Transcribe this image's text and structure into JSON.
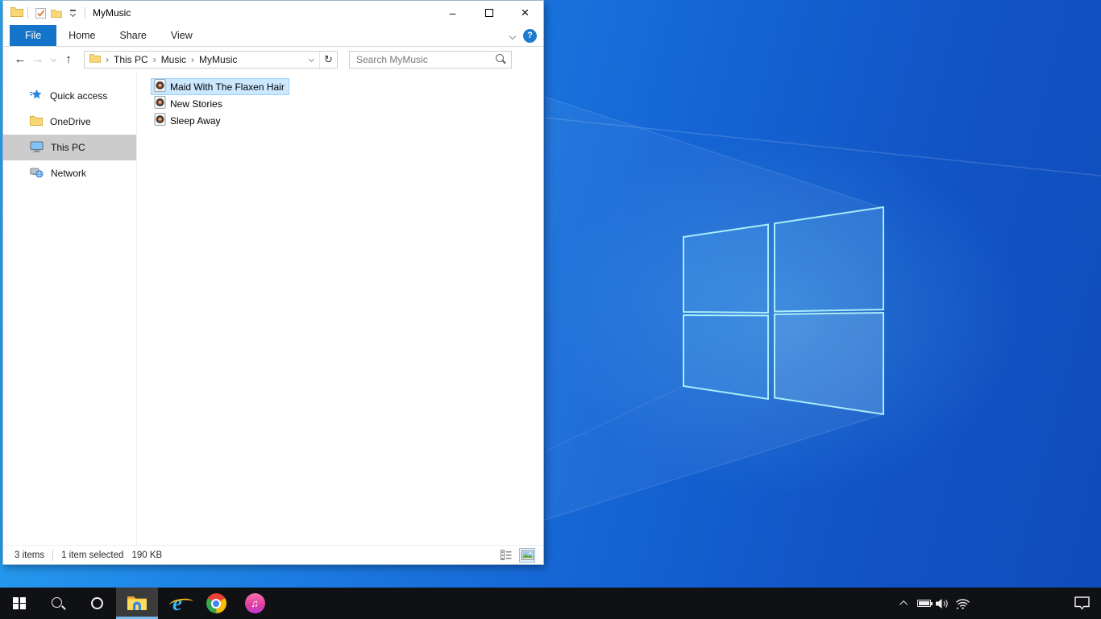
{
  "window": {
    "title": "MyMusic"
  },
  "icons": {
    "back": "←",
    "forward": "→",
    "up": "↑",
    "refresh": "↻",
    "help": "?",
    "minimize": "–",
    "close": "×",
    "check": "✓",
    "breadcrumb_sep": "›",
    "music_note": "♫"
  },
  "ribbon": {
    "tabs": [
      "File",
      "Home",
      "Share",
      "View"
    ]
  },
  "navbar": {
    "breadcrumb": [
      "This PC",
      "Music",
      "MyMusic"
    ],
    "search_placeholder": "Search MyMusic"
  },
  "sidebar": {
    "items": [
      {
        "label": "Quick access"
      },
      {
        "label": "OneDrive"
      },
      {
        "label": "This PC"
      },
      {
        "label": "Network"
      }
    ]
  },
  "files": [
    {
      "name": "Maid With The Flaxen Hair"
    },
    {
      "name": "New Stories"
    },
    {
      "name": "Sleep Away"
    }
  ],
  "statusbar": {
    "items_count": "3 items",
    "selected": "1 item selected",
    "size": "190 KB"
  },
  "taskbar": {
    "apps": [
      "start",
      "search",
      "cortana",
      "file-explorer",
      "internet-explorer",
      "chrome",
      "itunes"
    ],
    "tray": [
      "hidden-icons",
      "battery",
      "volume",
      "network"
    ],
    "action_center": "notifications"
  },
  "colors": {
    "accent": "#1374c9",
    "selection_bg": "#cce8ff",
    "selection_border": "#99d1ff",
    "taskbar_underline": "#76b9ed",
    "wallpaper_light": "#2ba6f3",
    "wallpaper_dark": "#0f4cba"
  }
}
